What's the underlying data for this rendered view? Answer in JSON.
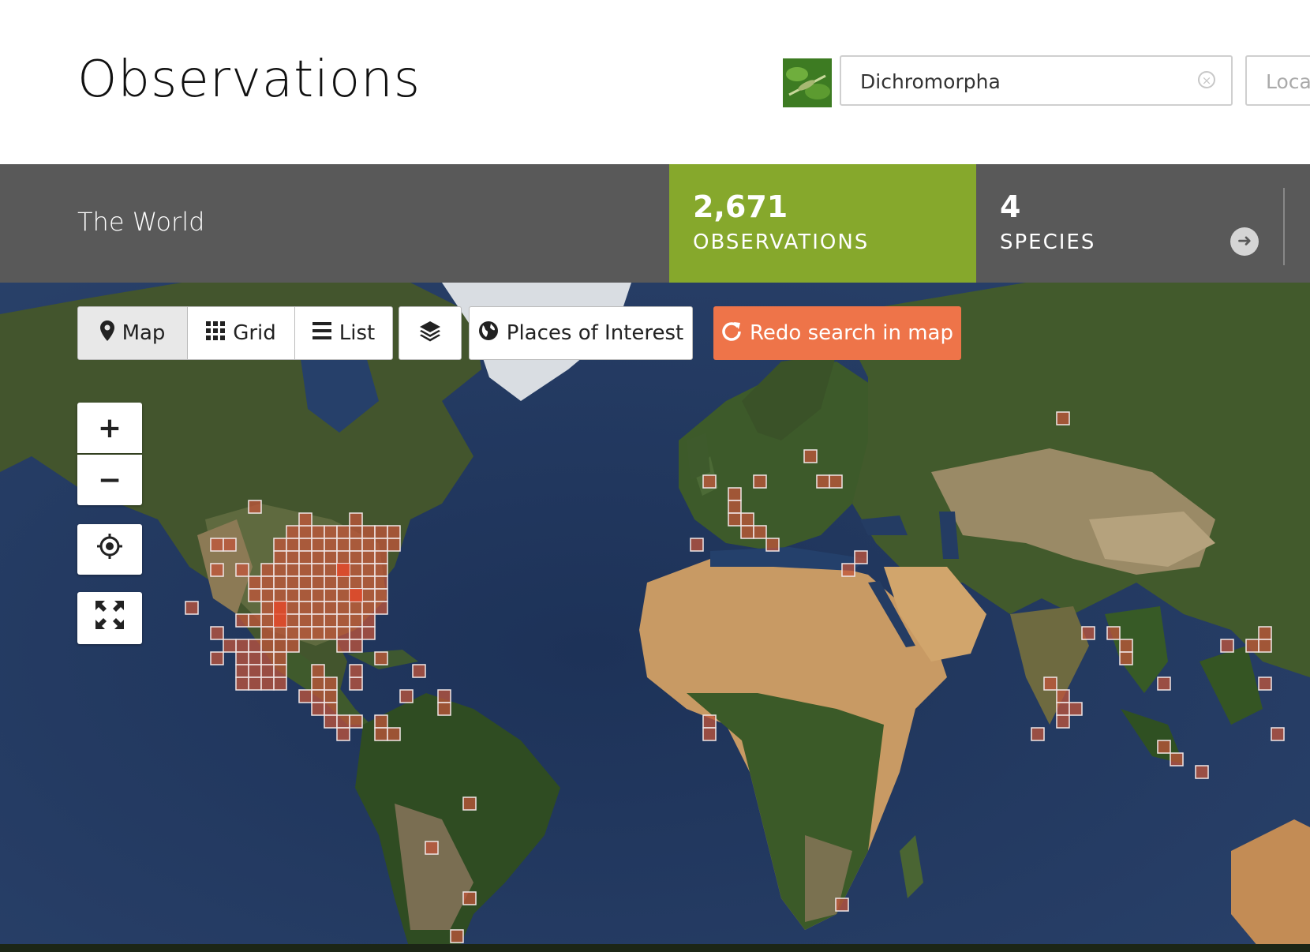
{
  "header": {
    "title": "Observations",
    "taxon_value": "Dichromorpha",
    "location_placeholder": "Locat"
  },
  "stats": {
    "place": "The World",
    "observations_count": "2,671",
    "observations_label": "OBSERVATIONS",
    "species_count": "4",
    "species_label": "SPECIES"
  },
  "toolbar": {
    "map": "Map",
    "grid": "Grid",
    "list": "List",
    "places": "Places of Interest",
    "redo": "Redo search in map"
  },
  "map_controls": {
    "zoom_in": "+",
    "zoom_out": "−"
  },
  "colors": {
    "accent_green": "#86a82c",
    "stats_bg": "#595959",
    "redo_orange": "#ee7449",
    "ocean": "#22375c"
  }
}
